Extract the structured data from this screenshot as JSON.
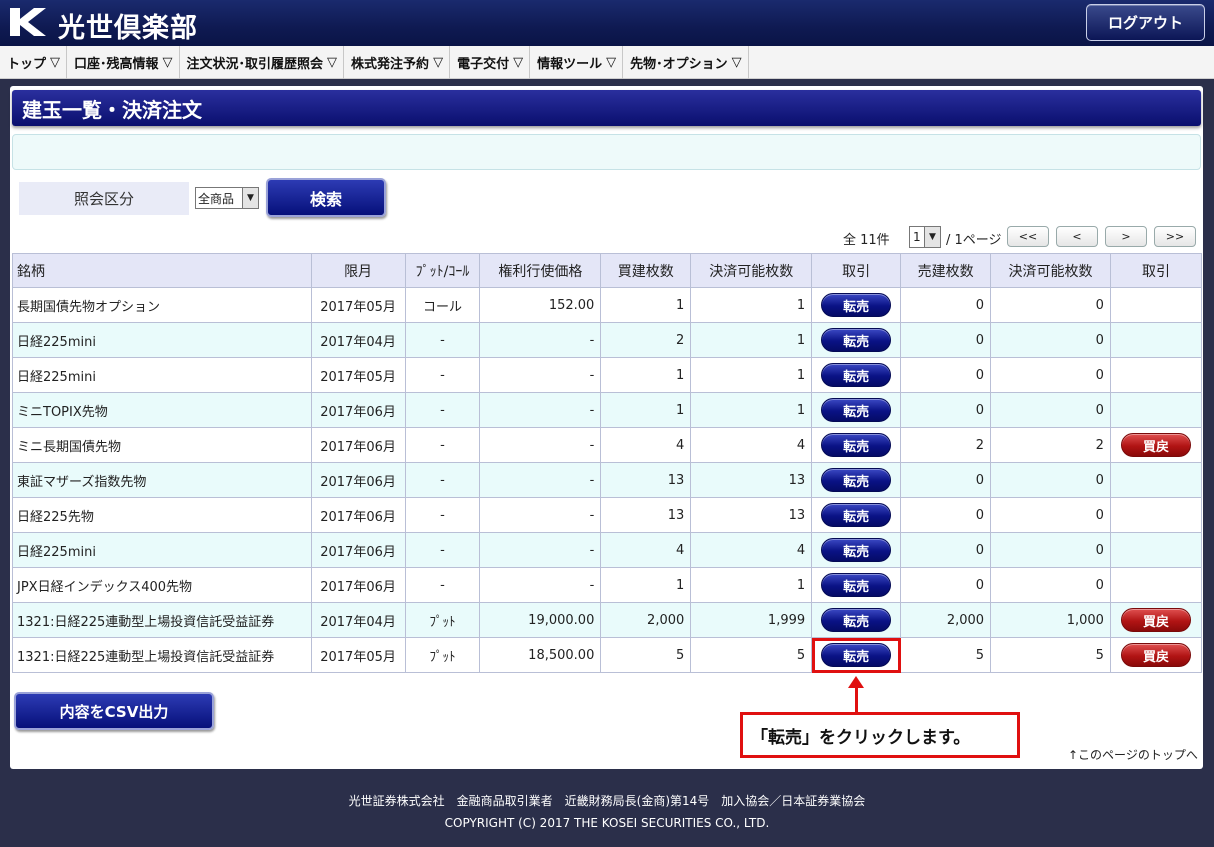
{
  "header": {
    "logo_text": "光世倶楽部",
    "logout_label": "ログアウト"
  },
  "nav": {
    "items": [
      {
        "label": "トップ"
      },
      {
        "label": "口座･残高情報"
      },
      {
        "label": "注文状況･取引履歴照会"
      },
      {
        "label": "株式発注予約"
      },
      {
        "label": "電子交付"
      },
      {
        "label": "情報ツール"
      },
      {
        "label": "先物･オプション"
      }
    ]
  },
  "page": {
    "title": "建玉一覧・決済注文",
    "filter_label": "照会区分",
    "filter_value": "全商品",
    "search_label": "検索",
    "total": "全 11件",
    "page_value": "1",
    "page_of": "/ 1ページ",
    "pager": {
      "first": "<<",
      "prev": "<",
      "next": ">",
      "last": ">>"
    }
  },
  "table": {
    "headers": [
      "銘柄",
      "限月",
      "ﾌﾟｯﾄ/ｺｰﾙ",
      "権利行使価格",
      "買建枚数",
      "決済可能枚数",
      "取引",
      "売建枚数",
      "決済可能枚数",
      "取引"
    ],
    "sell_label": "転売",
    "buy_label": "買戻",
    "rows": [
      {
        "name": "長期国債先物オプション",
        "month": "2017年05月",
        "pc": "コール",
        "strike": "152.00",
        "buy_qty": "1",
        "buy_avail": "1",
        "sell_qty": "0",
        "sell_avail": "0",
        "buyback": false
      },
      {
        "name": "日経225mini",
        "month": "2017年04月",
        "pc": "-",
        "strike": "-",
        "buy_qty": "2",
        "buy_avail": "1",
        "sell_qty": "0",
        "sell_avail": "0",
        "buyback": false
      },
      {
        "name": "日経225mini",
        "month": "2017年05月",
        "pc": "-",
        "strike": "-",
        "buy_qty": "1",
        "buy_avail": "1",
        "sell_qty": "0",
        "sell_avail": "0",
        "buyback": false
      },
      {
        "name": "ミニTOPIX先物",
        "month": "2017年06月",
        "pc": "-",
        "strike": "-",
        "buy_qty": "1",
        "buy_avail": "1",
        "sell_qty": "0",
        "sell_avail": "0",
        "buyback": false
      },
      {
        "name": "ミニ長期国債先物",
        "month": "2017年06月",
        "pc": "-",
        "strike": "-",
        "buy_qty": "4",
        "buy_avail": "4",
        "sell_qty": "2",
        "sell_avail": "2",
        "buyback": true
      },
      {
        "name": "東証マザーズ指数先物",
        "month": "2017年06月",
        "pc": "-",
        "strike": "-",
        "buy_qty": "13",
        "buy_avail": "13",
        "sell_qty": "0",
        "sell_avail": "0",
        "buyback": false
      },
      {
        "name": "日経225先物",
        "month": "2017年06月",
        "pc": "-",
        "strike": "-",
        "buy_qty": "13",
        "buy_avail": "13",
        "sell_qty": "0",
        "sell_avail": "0",
        "buyback": false
      },
      {
        "name": "日経225mini",
        "month": "2017年06月",
        "pc": "-",
        "strike": "-",
        "buy_qty": "4",
        "buy_avail": "4",
        "sell_qty": "0",
        "sell_avail": "0",
        "buyback": false
      },
      {
        "name": "JPX日経インデックス400先物",
        "month": "2017年06月",
        "pc": "-",
        "strike": "-",
        "buy_qty": "1",
        "buy_avail": "1",
        "sell_qty": "0",
        "sell_avail": "0",
        "buyback": false
      },
      {
        "name": "1321:日経225連動型上場投資信託受益証券",
        "month": "2017年04月",
        "pc": "ﾌﾟｯﾄ",
        "strike": "19,000.00",
        "buy_qty": "2,000",
        "buy_avail": "1,999",
        "sell_qty": "2,000",
        "sell_avail": "1,000",
        "buyback": true
      },
      {
        "name": "1321:日経225連動型上場投資信託受益証券",
        "month": "2017年05月",
        "pc": "ﾌﾟｯﾄ",
        "strike": "18,500.00",
        "buy_qty": "5",
        "buy_avail": "5",
        "sell_qty": "5",
        "sell_avail": "5",
        "buyback": true
      }
    ]
  },
  "csv_label": "内容をCSV出力",
  "callout_text": "「転売」をクリックします。",
  "to_top": "↑このページのトップへ",
  "footer": {
    "line1": "光世証券株式会社　金融商品取引業者　近畿財務局長(金商)第14号　加入協会／日本証券業協会",
    "line2": "COPYRIGHT (C) 2017 THE KOSEI SECURITIES CO., LTD."
  }
}
